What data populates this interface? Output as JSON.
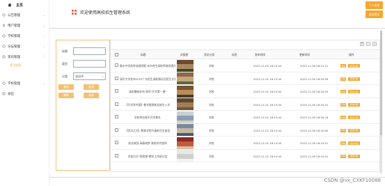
{
  "sidebar": {
    "home_label": "主页",
    "items": [
      {
        "label": "公告管理"
      },
      {
        "label": "用户管理"
      },
      {
        "label": "学校管理"
      },
      {
        "label": "论坛管理"
      },
      {
        "label": "资讯管理"
      }
    ],
    "sub_item": "资讯列表",
    "items_after": [
      {
        "label": "学校管理"
      },
      {
        "label": "退出"
      }
    ]
  },
  "header": {
    "title": "欢迎使用高校招生管理系统",
    "btn_personal": "个人信息",
    "btn_logout": "退出登录"
  },
  "search": {
    "title_label": "标题",
    "type_label": "类型",
    "category_label": "分类",
    "category_value": "请选择",
    "btn_search": "查询",
    "btn_add": "新增",
    "btn_delete": "删除",
    "btn_report": "报表"
  },
  "table": {
    "headers": [
      "标题",
      "封面图",
      "资讯分类",
      "标签",
      "发布时间",
      "更新时间",
      "操作"
    ],
    "rows": [
      {
        "title": "衡水中学高考成绩亮眼 本市考生录取率继续提升",
        "category": "学校",
        "tag": "",
        "published": "2023-11-01 16:13:44",
        "updated": "2023-11-09 16:21:21"
      },
      {
        "title": "清华大学发布2023广东招生录取情况及招生计划",
        "category": "学校",
        "tag": "",
        "published": "2023-11-01 16:13:44",
        "updated": "2023-11-09 16:20:59"
      },
      {
        "title": "该校最新发布 探究\"开学第一课\"",
        "category": "学校",
        "tag": "",
        "published": "2023-11-01 16:13:44",
        "updated": "2023-11-09 16:20:53"
      },
      {
        "title": "【开学季专题】教学楼焕新迎新生入学",
        "category": "学校",
        "tag": "",
        "published": "2023-11-01 16:13:44",
        "updated": "2023-11-09 16:20:31"
      },
      {
        "title": "学校举办新生开学典礼",
        "category": "学校",
        "tag": "",
        "published": "2023-11-01 16:13:44",
        "updated": "2023-11-09 16:20:18"
      },
      {
        "title": "【资讯之光】教育学院开展新生见面会",
        "category": "学校",
        "tag": "",
        "published": "2023-11-01 16:13:44",
        "updated": "2023-11-09 16:20:00"
      },
      {
        "title": "校长致辞 青春筑梦 勇担时代使命",
        "category": "学校",
        "tag": "",
        "published": "2023-11-01 16:13:44",
        "updated": "2023-11-09 16:19:51"
      },
      {
        "title": "学校召开\"思政课\"教学工作研讨会",
        "category": "学校",
        "tag": "",
        "published": "2023-11-01 16:13:44",
        "updated": "2023-11-09 16:19:41"
      }
    ],
    "btn_view": "详情",
    "btn_edit": "修改内容"
  },
  "watermark": "CSDN @vx_CXKF10088",
  "colors": {
    "accent": "#f4a72f",
    "accent_light": "#f4c070"
  }
}
